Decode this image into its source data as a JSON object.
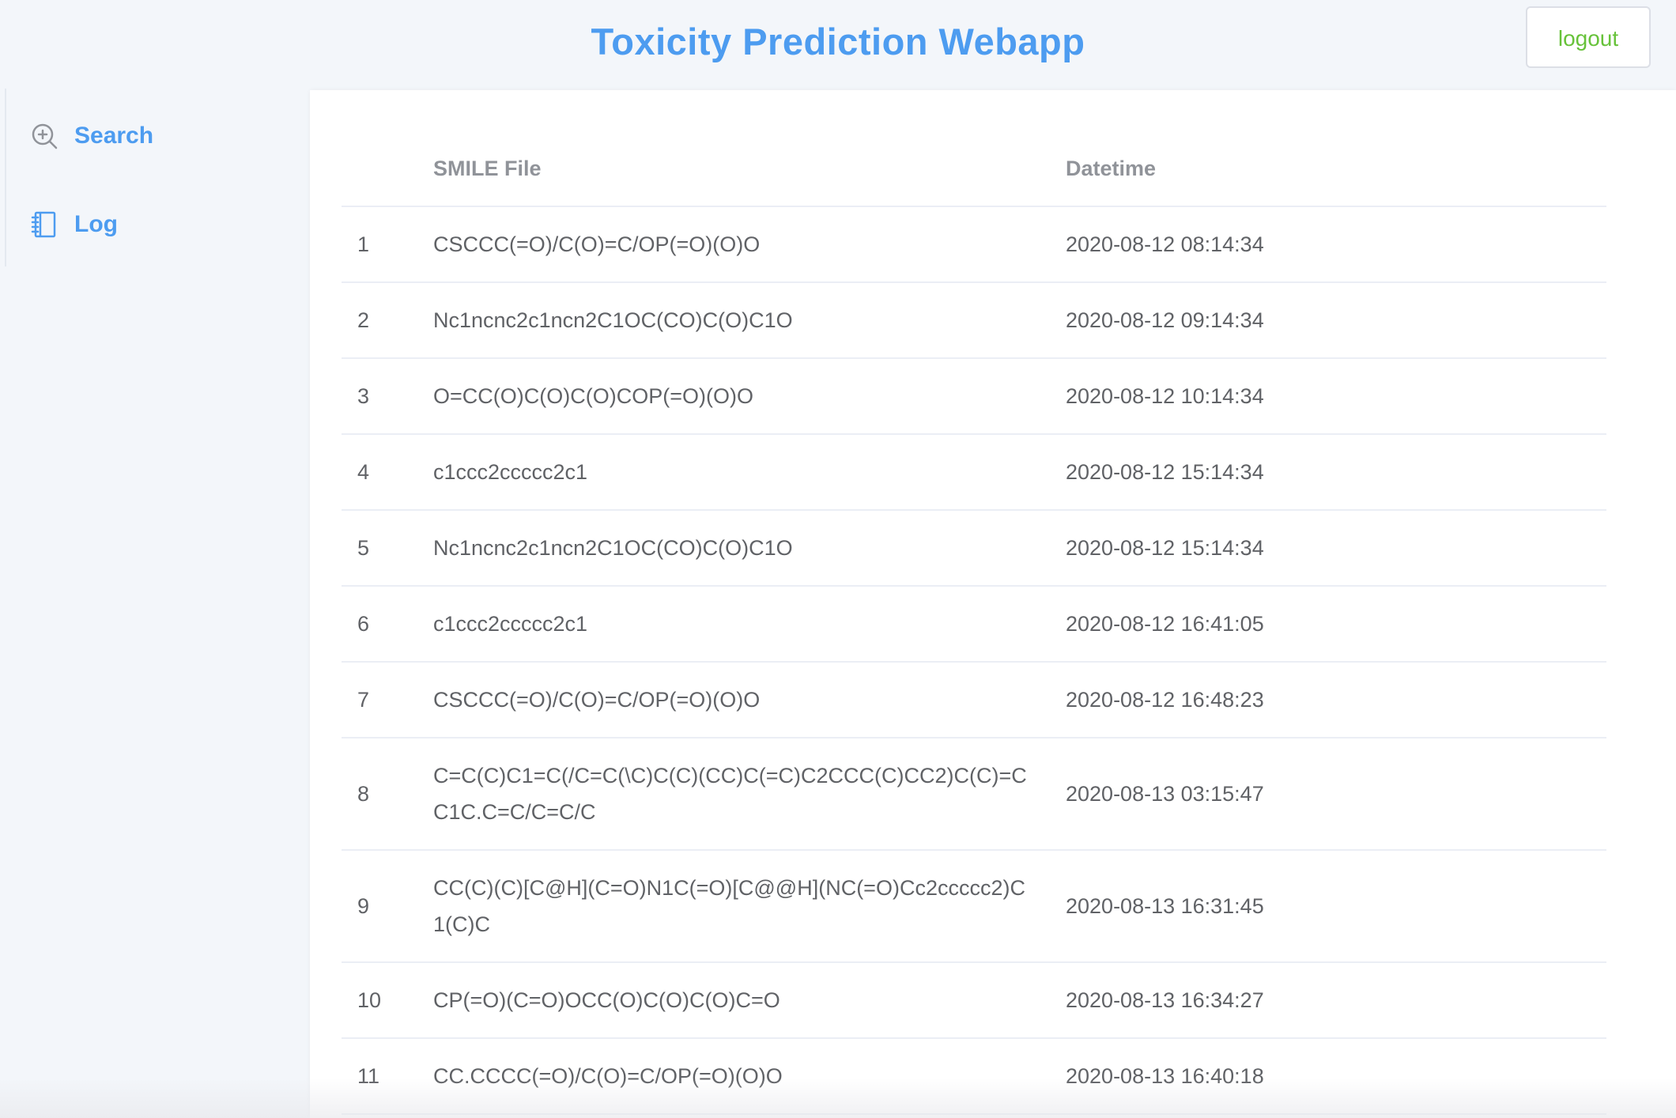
{
  "header": {
    "title": "Toxicity Prediction Webapp",
    "logout_label": "logout"
  },
  "sidebar": {
    "items": [
      {
        "label": "Search",
        "icon": "zoom-in-icon"
      },
      {
        "label": "Log",
        "icon": "notebook-icon"
      }
    ]
  },
  "table": {
    "columns": [
      "",
      "SMILE File",
      "Datetime"
    ],
    "rows": [
      {
        "index": "1",
        "smile": "CSCCC(=O)/C(O)=C/OP(=O)(O)O",
        "datetime": "2020-08-12 08:14:34"
      },
      {
        "index": "2",
        "smile": "Nc1ncnc2c1ncn2C1OC(CO)C(O)C1O",
        "datetime": "2020-08-12 09:14:34"
      },
      {
        "index": "3",
        "smile": "O=CC(O)C(O)C(O)COP(=O)(O)O",
        "datetime": "2020-08-12 10:14:34"
      },
      {
        "index": "4",
        "smile": "c1ccc2ccccc2c1",
        "datetime": "2020-08-12 15:14:34"
      },
      {
        "index": "5",
        "smile": "Nc1ncnc2c1ncn2C1OC(CO)C(O)C1O",
        "datetime": "2020-08-12 15:14:34"
      },
      {
        "index": "6",
        "smile": "c1ccc2ccccc2c1",
        "datetime": "2020-08-12 16:41:05"
      },
      {
        "index": "7",
        "smile": "CSCCC(=O)/C(O)=C/OP(=O)(O)O",
        "datetime": "2020-08-12 16:48:23"
      },
      {
        "index": "8",
        "smile": "C=C(C)C1=C(/C=C(\\C)C(C)(CC)C(=C)C2CCC(C)CC2)C(C)=CC1C.C=C/C=C/C",
        "datetime": "2020-08-13 03:15:47"
      },
      {
        "index": "9",
        "smile": "CC(C)(C)[C@H](C=O)N1C(=O)[C@@H](NC(=O)Cc2ccccc2)C1(C)C",
        "datetime": "2020-08-13 16:31:45"
      },
      {
        "index": "10",
        "smile": "CP(=O)(C=O)OCC(O)C(O)C(O)C=O",
        "datetime": "2020-08-13 16:34:27"
      },
      {
        "index": "11",
        "smile": "CC.CCCC(=O)/C(O)=C/OP(=O)(O)O",
        "datetime": "2020-08-13 16:40:18"
      }
    ]
  },
  "colors": {
    "accent": "#4d9cf0",
    "logout": "#67c23a",
    "text": "#606266",
    "header_text": "#909399"
  }
}
